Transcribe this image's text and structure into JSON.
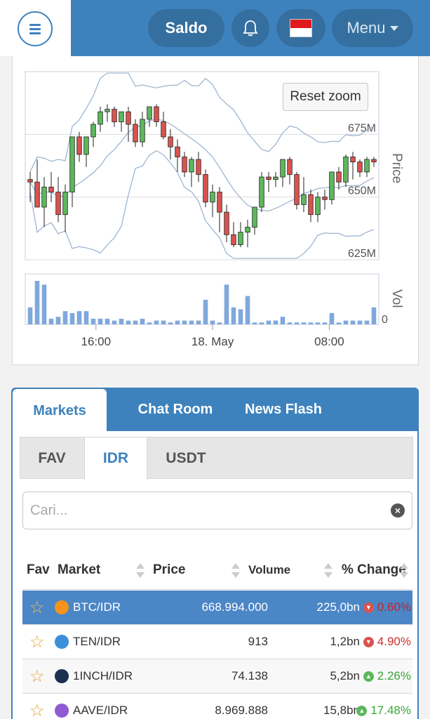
{
  "header": {
    "saldo_label": "Saldo",
    "menu_label": "Menu",
    "accent_color": "#3d82bd"
  },
  "chart": {
    "reset_zoom_label": "Reset zoom",
    "price_axis_title": "Price",
    "volume_axis_title": "Vol",
    "price_ticks": [
      "675M",
      "650M",
      "625M"
    ],
    "volume_tick": "0",
    "x_ticks": [
      "16:00",
      "18. May",
      "08:00"
    ]
  },
  "chart_data": {
    "type": "candlestick",
    "price_axis": {
      "title": "Price",
      "ticks": [
        625,
        650,
        675
      ],
      "unit": "M",
      "range": [
        625,
        700
      ]
    },
    "volume_axis": {
      "title": "Vol",
      "ticks": [
        0
      ]
    },
    "x_ticks": [
      "16:00",
      "18. May",
      "08:00"
    ],
    "indicators": [
      "bollinger-bands"
    ],
    "candles": [
      [
        657,
        660,
        648,
        656
      ],
      [
        656,
        665,
        650,
        646
      ],
      [
        646,
        658,
        638,
        654
      ],
      [
        654,
        660,
        648,
        652
      ],
      [
        652,
        658,
        640,
        643
      ],
      [
        643,
        655,
        636,
        652
      ],
      [
        652,
        674,
        646,
        674
      ],
      [
        674,
        676,
        664,
        667
      ],
      [
        667,
        674,
        662,
        674
      ],
      [
        674,
        680,
        670,
        679
      ],
      [
        679,
        686,
        676,
        684
      ],
      [
        684,
        687,
        680,
        685
      ],
      [
        685,
        686,
        678,
        680
      ],
      [
        680,
        684,
        676,
        684
      ],
      [
        684,
        686,
        672,
        679
      ],
      [
        679,
        681,
        670,
        672
      ],
      [
        672,
        684,
        670,
        681
      ],
      [
        681,
        686,
        678,
        686
      ],
      [
        686,
        687,
        678,
        680
      ],
      [
        680,
        684,
        673,
        674
      ],
      [
        674,
        677,
        665,
        670
      ],
      [
        670,
        673,
        660,
        666
      ],
      [
        666,
        668,
        658,
        660
      ],
      [
        660,
        666,
        654,
        665
      ],
      [
        665,
        668,
        656,
        659
      ],
      [
        659,
        661,
        646,
        648
      ],
      [
        648,
        655,
        642,
        652
      ],
      [
        652,
        654,
        636,
        644
      ],
      [
        644,
        647,
        632,
        635
      ],
      [
        635,
        640,
        630,
        631
      ],
      [
        631,
        640,
        630,
        636
      ],
      [
        636,
        641,
        630,
        638
      ],
      [
        638,
        646,
        635,
        646
      ],
      [
        646,
        660,
        644,
        658
      ],
      [
        658,
        660,
        652,
        657
      ],
      [
        657,
        660,
        654,
        658
      ],
      [
        658,
        665,
        654,
        665
      ],
      [
        665,
        666,
        655,
        659
      ],
      [
        659,
        660,
        645,
        647
      ],
      [
        647,
        658,
        644,
        651
      ],
      [
        651,
        653,
        640,
        643
      ],
      [
        643,
        652,
        640,
        650
      ],
      [
        650,
        653,
        645,
        649
      ],
      [
        649,
        660,
        647,
        660
      ],
      [
        660,
        662,
        653,
        656
      ],
      [
        656,
        667,
        654,
        666
      ],
      [
        666,
        668,
        657,
        664
      ],
      [
        664,
        665,
        658,
        660
      ],
      [
        660,
        666,
        658,
        665
      ],
      [
        665,
        666,
        662,
        664
      ]
    ],
    "volumes": [
      9,
      23,
      21,
      3,
      4,
      7,
      6,
      7,
      7,
      3,
      3,
      3,
      2,
      3,
      2,
      2,
      3,
      1,
      2,
      2,
      1,
      2,
      2,
      2,
      2,
      13,
      2,
      1,
      21,
      9,
      8,
      15,
      1,
      1,
      2,
      2,
      4,
      1,
      1,
      1,
      1,
      1,
      1,
      6,
      1,
      2,
      2,
      2,
      2,
      9
    ]
  },
  "tabs": [
    "Markets",
    "Chat Room",
    "News Flash"
  ],
  "subtabs": [
    "FAV",
    "IDR",
    "USDT"
  ],
  "search": {
    "placeholder": "Cari..."
  },
  "table": {
    "headers": {
      "fav": "Fav",
      "market": "Market",
      "price": "Price",
      "volume": "Volume",
      "change": "% Change"
    },
    "rows": [
      {
        "market": "BTC/IDR",
        "price": "668.994.000",
        "volume": "225,0bn",
        "change": "0.60%",
        "direction": "down",
        "coin_color": "#f7931a",
        "coin_icon": "bitcoin-icon"
      },
      {
        "market": "TEN/IDR",
        "price": "913",
        "volume": "1,2bn",
        "change": "4.90%",
        "direction": "down",
        "coin_color": "#3b8fd8",
        "coin_icon": "tokenomy-icon"
      },
      {
        "market": "1INCH/IDR",
        "price": "74.138",
        "volume": "5,2bn",
        "change": "2.26%",
        "direction": "up",
        "coin_color": "#1b314f",
        "coin_icon": "1inch-icon"
      },
      {
        "market": "AAVE/IDR",
        "price": "8.969.888",
        "volume": "15,8bn",
        "change": "17.48%",
        "direction": "up",
        "coin_color": "#8f5ad3",
        "coin_icon": "aave-icon"
      }
    ]
  },
  "colors": {
    "up": "#5cb85c",
    "down": "#d9534f",
    "up_text": "#3aa53a",
    "down_text": "#c9302c"
  }
}
